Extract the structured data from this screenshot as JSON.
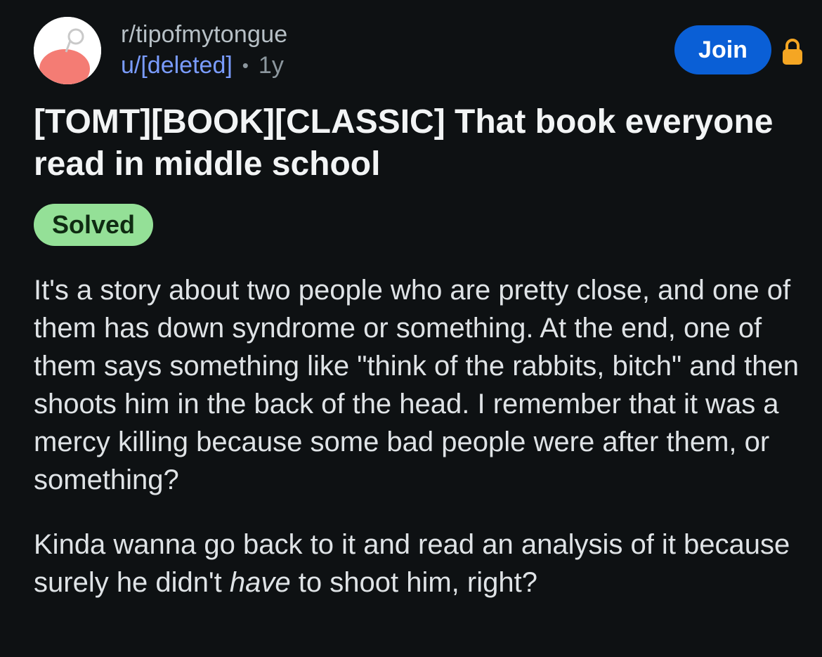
{
  "post": {
    "subreddit": "r/tipofmytongue",
    "author": "u/[deleted]",
    "separator": "•",
    "age": "1y",
    "join_label": "Join",
    "title": "[TOMT][BOOK][CLASSIC] That book everyone read in middle school",
    "flair": "Solved",
    "body_p1": "It's a story about two people who are pretty close, and one of them has down syndrome or something. At the end, one of them says something like \"think of the rabbits, bitch\" and then shoots him in the back of the head. I remember that it was a mercy killing because some bad people were after them, or something?",
    "body_p2_before": "Kinda wanna go back to it and read an analysis of  it because surely he didn't ",
    "body_p2_emphasis": "have",
    "body_p2_after": " to shoot him, right?"
  },
  "icons": {
    "avatar": "subreddit-avatar-icon",
    "lock": "lock-icon"
  },
  "colors": {
    "background": "#0e1113",
    "join_button": "#0a5fd6",
    "lock": "#f5a623",
    "flair_bg": "#94e097",
    "author_link": "#7a9cff"
  }
}
